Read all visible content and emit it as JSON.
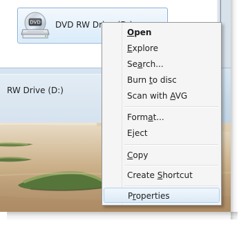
{
  "explorer": {
    "drive_tile_label": "DVD RW Drive (D:)",
    "drive_icon": "dvd-drive-icon",
    "drive_badge": "DVD"
  },
  "details_pane": {
    "label": "RW Drive (D:)"
  },
  "context_menu": {
    "items": [
      {
        "label": "Open",
        "parts": [
          "",
          "O",
          "pen"
        ]
      },
      {
        "label": "Explore",
        "parts": [
          "",
          "E",
          "xplore"
        ]
      },
      {
        "label": "Search...",
        "parts": [
          "Se",
          "a",
          "rch..."
        ]
      },
      {
        "label": "Burn to disc",
        "parts": [
          "Burn ",
          "t",
          "o disc"
        ]
      },
      {
        "label": "Scan with AVG",
        "parts": [
          "Scan with ",
          "A",
          "VG"
        ]
      },
      {
        "label": "Format...",
        "parts": [
          "Form",
          "a",
          "t..."
        ]
      },
      {
        "label": "Eject",
        "parts": [
          "E",
          "j",
          "ect"
        ]
      },
      {
        "label": "Copy",
        "parts": [
          "",
          "C",
          "opy"
        ]
      },
      {
        "label": "Create Shortcut",
        "parts": [
          "Create ",
          "S",
          "hortcut"
        ]
      },
      {
        "label": "Properties",
        "parts": [
          "P",
          "r",
          "operties"
        ]
      }
    ]
  },
  "colors": {
    "tile_border": "#84acd5",
    "tile_fill_top": "#f3f8fd",
    "tile_fill_bottom": "#d9ebfa",
    "menu_bg": "#f5f5f5",
    "menu_border": "#979797",
    "menu_hover_border": "#a8d1f2",
    "text": "#1d1d1d"
  }
}
